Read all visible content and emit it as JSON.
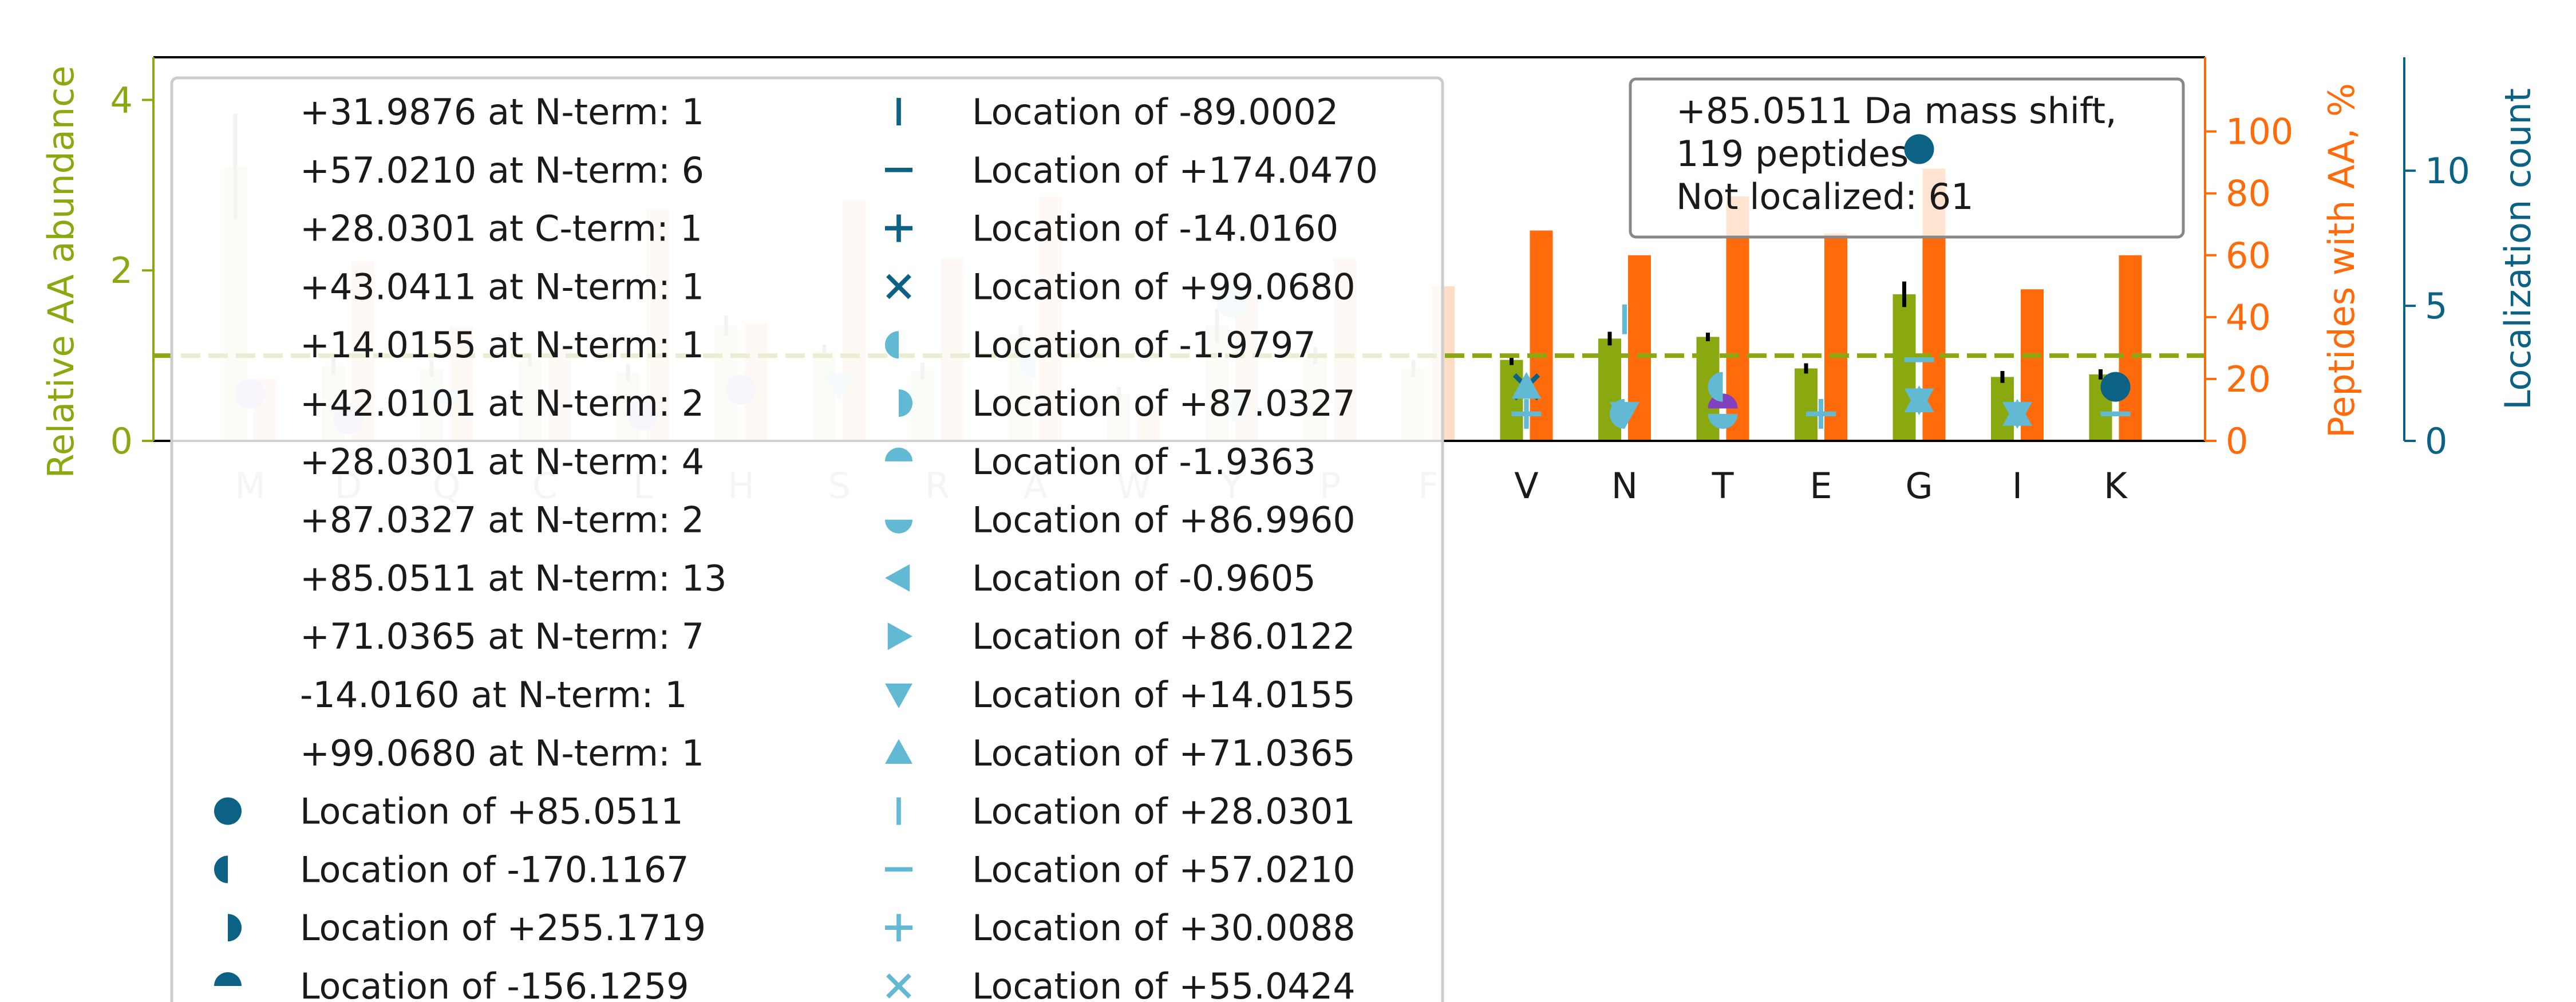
{
  "colors": {
    "abundance": "#8aa80f",
    "abundance_faded": "#e3eccb",
    "peptides": "#ff6a0a",
    "peptides_faded": "#ffdcc6",
    "localization": "#0b6285",
    "location_light": "#62b9d3",
    "abundance_err": "#000000",
    "abundance_err_faded": "#bdbdbd",
    "nterm_marker": "#8040c0",
    "nterm_marker_faded": "#d9c8ef",
    "loc_faded": "#c5e4ee"
  },
  "chart_data": {
    "type": "bar",
    "categories": [
      "M",
      "D",
      "Q",
      "C",
      "L",
      "H",
      "S",
      "R",
      "A",
      "W",
      "Y",
      "P",
      "F",
      "V",
      "N",
      "T",
      "E",
      "G",
      "I",
      "K"
    ],
    "faded_categories": [
      "M",
      "D",
      "Q",
      "C",
      "L",
      "H",
      "S",
      "R",
      "A",
      "W",
      "Y",
      "P",
      "F"
    ],
    "y_left": {
      "label": "Relative AA abundance",
      "ticks": [
        "0",
        "2",
        "4"
      ],
      "lim": [
        0,
        4.5
      ]
    },
    "y_right": {
      "label": "Peptides with AA, %",
      "ticks": [
        "0",
        "20",
        "40",
        "60",
        "80",
        "100"
      ],
      "lim": [
        0,
        124
      ]
    },
    "y_right2": {
      "label": "Localization count",
      "ticks": [
        "0",
        "5",
        "10"
      ],
      "lim": [
        0,
        14.2
      ]
    },
    "reference_line": 1.0,
    "series": [
      {
        "name": "Relative AA abundance",
        "values": [
          3.22,
          0.88,
          0.85,
          0.95,
          0.8,
          1.35,
          1.05,
          0.82,
          1.25,
          0.55,
          1.35,
          1.0,
          0.85,
          0.95,
          1.2,
          1.22,
          0.85,
          1.72,
          0.75,
          0.78
        ],
        "errors": [
          0.62,
          0.1,
          0.1,
          0.08,
          0.1,
          0.12,
          0.08,
          0.1,
          0.1,
          0.08,
          0.2,
          0.1,
          0.1,
          0.06,
          0.08,
          0.05,
          0.06,
          0.15,
          0.07,
          0.06
        ]
      },
      {
        "name": "Peptides with AA, %",
        "values": [
          20,
          58,
          37,
          30,
          75,
          38,
          78,
          59,
          79,
          11,
          47,
          59,
          50,
          68,
          60,
          79,
          67,
          88,
          49,
          60
        ]
      }
    ],
    "localization_counts": [
      {
        "category": "V",
        "count": 1,
        "marker": "plus"
      },
      {
        "category": "V",
        "count": 2,
        "marker": "x"
      },
      {
        "category": "V",
        "count": 2,
        "marker": "triangle-up"
      },
      {
        "category": "N",
        "count": 1,
        "marker": "triangle-down"
      },
      {
        "category": "N",
        "count": 4.5,
        "marker": "vline"
      },
      {
        "category": "N",
        "count": 1,
        "marker": "half-left"
      },
      {
        "category": "T",
        "count": 1,
        "marker": "half-bottom"
      },
      {
        "category": "T",
        "count": 2,
        "marker": "half-left"
      },
      {
        "category": "E",
        "count": 1,
        "marker": "plus"
      },
      {
        "category": "G",
        "count": 10.8,
        "marker": "circle"
      },
      {
        "category": "G",
        "count": 3,
        "marker": "hline"
      },
      {
        "category": "G",
        "count": 1.5,
        "marker": "triangle-up"
      },
      {
        "category": "G",
        "count": 1.5,
        "marker": "triangle-down"
      },
      {
        "category": "I",
        "count": 1,
        "marker": "triangle-up"
      },
      {
        "category": "I",
        "count": 1,
        "marker": "triangle-down"
      },
      {
        "category": "K",
        "count": 2,
        "marker": "circle"
      },
      {
        "category": "K",
        "count": 1,
        "marker": "hline"
      }
    ],
    "nterm_markers": [
      {
        "category": "M",
        "value": 0.55
      },
      {
        "category": "D",
        "value": 0.25
      },
      {
        "category": "L",
        "value": 0.3
      },
      {
        "category": "H",
        "value": 0.6
      },
      {
        "category": "T",
        "value": 0.38
      }
    ],
    "faded_location_markers": [
      {
        "category": "Q",
        "value": 0.6,
        "marker": "half-bottom"
      },
      {
        "category": "S",
        "value": 0.65,
        "marker": "triangle-down"
      },
      {
        "category": "A",
        "value": 0.9,
        "marker": "half-left"
      },
      {
        "category": "Y",
        "value": 1.62,
        "marker": "circle"
      },
      {
        "category": "Y",
        "value": 0.4,
        "marker": "half-right"
      }
    ],
    "info_box": {
      "lines": [
        "+85.0511 Da mass shift,",
        "119 peptides",
        "Not localized: 61"
      ]
    },
    "legend": {
      "placement": "upper-left",
      "text_entries": [
        "+31.9876 at N-term: 1",
        "+57.0210 at N-term: 6",
        "+28.0301 at C-term: 1",
        "+43.0411 at N-term: 1",
        "+14.0155 at N-term: 1",
        "+42.0101 at N-term: 2",
        "+28.0301 at N-term: 4",
        "+87.0327 at N-term: 2",
        "+85.0511 at N-term: 13",
        "+71.0365 at N-term: 7",
        "-14.0160 at N-term: 1",
        "+99.0680 at N-term: 1"
      ],
      "location_entries": [
        {
          "label": "Location of +85.0511",
          "marker": "circle",
          "shade": "dark"
        },
        {
          "label": "Location of -170.1167",
          "marker": "half-left",
          "shade": "dark"
        },
        {
          "label": "Location of +255.1719",
          "marker": "half-right",
          "shade": "dark"
        },
        {
          "label": "Location of -156.1259",
          "marker": "half-top",
          "shade": "dark"
        },
        {
          "label": "Location of -89.0002",
          "marker": "vline",
          "shade": "dark"
        },
        {
          "label": "Location of +174.0470",
          "marker": "hline",
          "shade": "dark"
        },
        {
          "label": "Location of -14.0160",
          "marker": "plus",
          "shade": "dark"
        },
        {
          "label": "Location of +99.0680",
          "marker": "x",
          "shade": "dark"
        },
        {
          "label": "Location of -1.9797",
          "marker": "half-left",
          "shade": "light"
        },
        {
          "label": "Location of +87.0327",
          "marker": "half-right",
          "shade": "light"
        },
        {
          "label": "Location of -1.9363",
          "marker": "half-top",
          "shade": "light"
        },
        {
          "label": "Location of +86.9960",
          "marker": "half-bottom",
          "shade": "light"
        },
        {
          "label": "Location of -0.9605",
          "marker": "triangle-left",
          "shade": "light"
        },
        {
          "label": "Location of +86.0122",
          "marker": "triangle-right",
          "shade": "light"
        },
        {
          "label": "Location of +14.0155",
          "marker": "triangle-down",
          "shade": "light"
        },
        {
          "label": "Location of +71.0365",
          "marker": "triangle-up",
          "shade": "light"
        },
        {
          "label": "Location of +28.0301",
          "marker": "vline",
          "shade": "light"
        },
        {
          "label": "Location of +57.0210",
          "marker": "hline",
          "shade": "light"
        },
        {
          "label": "Location of +30.0088",
          "marker": "plus",
          "shade": "light"
        },
        {
          "label": "Location of +55.0424",
          "marker": "x",
          "shade": "light"
        }
      ]
    }
  }
}
